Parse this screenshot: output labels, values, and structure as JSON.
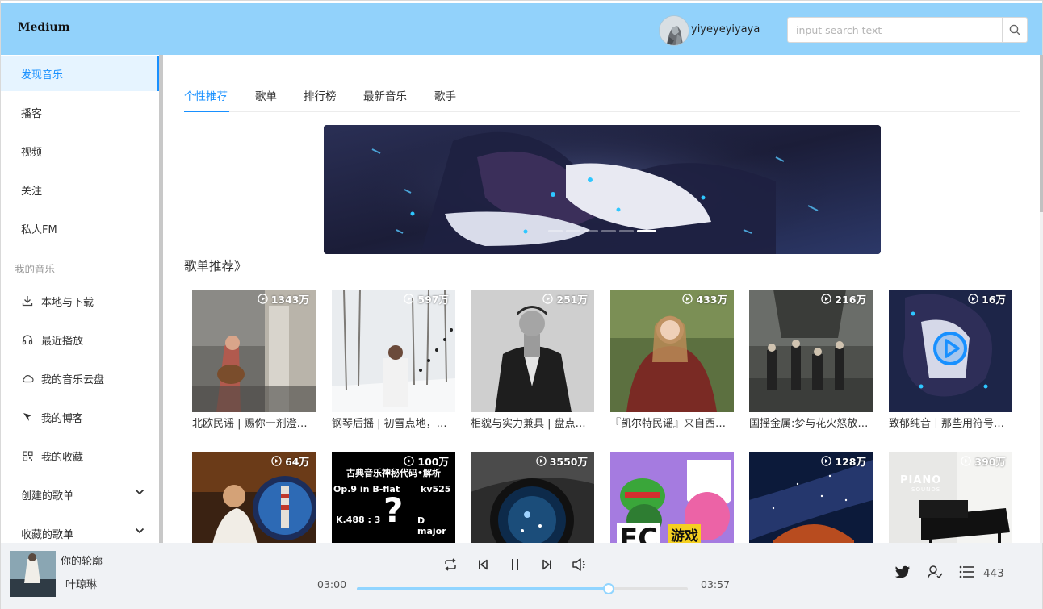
{
  "app": {
    "logo": "Medium",
    "username": "yiyeyeyiyaya",
    "search_placeholder": "input search text"
  },
  "sidebar": {
    "items": [
      {
        "label": "发现音乐",
        "active": true
      },
      {
        "label": "播客"
      },
      {
        "label": "视频"
      },
      {
        "label": "关注"
      },
      {
        "label": "私人FM"
      }
    ],
    "group_label": "我的音乐",
    "my_items": [
      {
        "label": "本地与下载",
        "icon": "download-icon"
      },
      {
        "label": "最近播放",
        "icon": "headphones-icon"
      },
      {
        "label": "我的音乐云盘",
        "icon": "cloud-icon"
      },
      {
        "label": "我的博客",
        "icon": "pin-icon"
      },
      {
        "label": "我的收藏",
        "icon": "qrcode-icon"
      }
    ],
    "collapsibles": [
      {
        "label": "创建的歌单"
      },
      {
        "label": "收藏的歌单"
      }
    ]
  },
  "tabs": [
    {
      "label": "个性推荐",
      "active": true
    },
    {
      "label": "歌单"
    },
    {
      "label": "排行榜"
    },
    {
      "label": "最新音乐"
    },
    {
      "label": "歌手"
    }
  ],
  "section_title": "歌单推荐》",
  "playlists": [
    {
      "plays": "1343万",
      "name": "北欧民谣 | 赐你一剂澄澈清凉的良药"
    },
    {
      "plays": "597万",
      "name": "钢琴后摇 | 初雪点地，悄然而至"
    },
    {
      "plays": "251万",
      "name": "相貌与实力兼具 | 盘点那些宝藏男歌手"
    },
    {
      "plays": "433万",
      "name": "『凯尔特民谣』来自西方的古老旋律"
    },
    {
      "plays": "216万",
      "name": "国摇金属:梦与花火怒放的摇滚"
    },
    {
      "plays": "16万",
      "name": "致郁纯音丨那些用符号诉说的故事"
    },
    {
      "plays": "64万",
      "name": ""
    },
    {
      "plays": "100万",
      "name": "",
      "cover_text": [
        "古典音乐神秘代码•解析",
        "Op.9 in B-flat",
        "kv525",
        "K.488 : 3",
        "?",
        "D major"
      ]
    },
    {
      "plays": "3550万",
      "name": ""
    },
    {
      "plays": "",
      "name": "",
      "cover_text": [
        "FC",
        "游戏"
      ]
    },
    {
      "plays": "128万",
      "name": ""
    },
    {
      "plays": "390万",
      "name": "",
      "cover_text": [
        "PIANO",
        "SOUNDS"
      ]
    }
  ],
  "player": {
    "song_title": "你的轮廓",
    "artist": "叶琼琳",
    "current_time": "03:00",
    "total_time": "03:57",
    "progress": 0.76,
    "playlist_count": "443"
  },
  "colors": {
    "header_bg": "#92d2fb",
    "accent": "#1890ff",
    "progress": "#91d5ff",
    "player_bg": "#f0f2f5"
  }
}
